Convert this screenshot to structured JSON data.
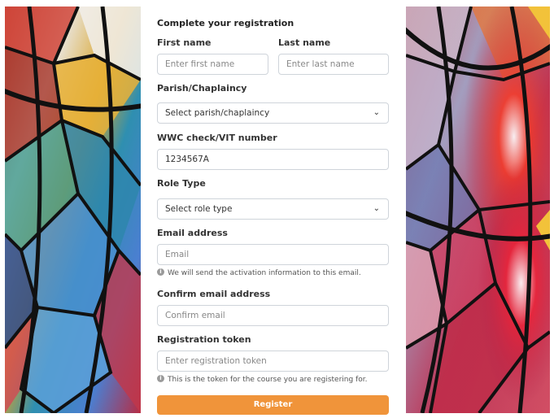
{
  "form": {
    "title": "Complete your registration",
    "first_name": {
      "label": "First name",
      "placeholder": "Enter first name"
    },
    "last_name": {
      "label": "Last name",
      "placeholder": "Enter last name"
    },
    "parish": {
      "label": "Parish/Chaplaincy",
      "selected": "Select parish/chaplaincy"
    },
    "wwc": {
      "label": "WWC check/VIT number",
      "value": "1234567A"
    },
    "role": {
      "label": "Role Type",
      "selected": "Select role type"
    },
    "email": {
      "label": "Email address",
      "placeholder": "Email",
      "hint": "We will send the activation information to this email."
    },
    "confirm_email": {
      "label": "Confirm email address",
      "placeholder": "Confirm email"
    },
    "token": {
      "label": "Registration token",
      "placeholder": "Enter registration token",
      "hint": "This is the token for the course you are registering for."
    },
    "register_label": "Register"
  },
  "icons": {
    "select_chevron": "chevron-down-icon",
    "info": "info-icon"
  },
  "colors": {
    "accent": "#f0943a",
    "border": "#cfd4da",
    "hint_icon": "#9a9a9a"
  }
}
